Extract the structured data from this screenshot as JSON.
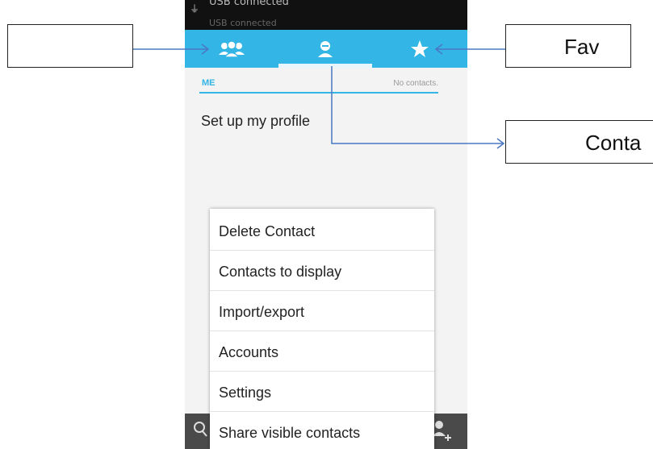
{
  "status_bar": {
    "text": "USB connected",
    "text2": "USB connected"
  },
  "tabs": [
    {
      "name": "groups",
      "icon": "people-icon"
    },
    {
      "name": "contacts",
      "icon": "person-icon",
      "selected": true
    },
    {
      "name": "favorites",
      "icon": "star-icon"
    }
  ],
  "profile": {
    "me_label": "ME",
    "no_contacts": "No contacts.",
    "setup_label": "Set up my profile"
  },
  "menu": {
    "items": [
      {
        "label": "Delete Contact"
      },
      {
        "label": "Contacts to display"
      },
      {
        "label": "Import/export"
      },
      {
        "label": "Accounts"
      },
      {
        "label": "Settings"
      },
      {
        "label": "Share visible contacts"
      }
    ]
  },
  "callouts": {
    "left_label": "",
    "fav_label": "Fav",
    "contacts_label": "Conta"
  },
  "colors": {
    "accent": "#33b5e5",
    "status_bar": "#111111",
    "arrow": "#4a78c2"
  }
}
